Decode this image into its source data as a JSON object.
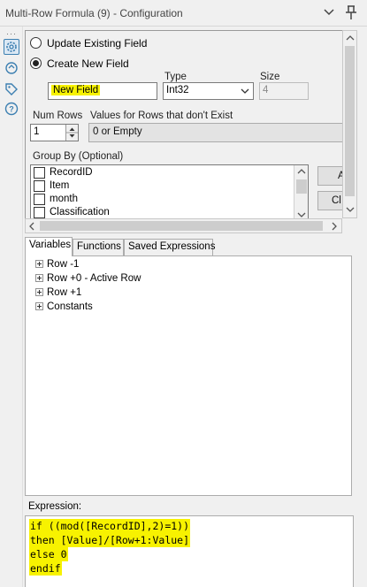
{
  "window": {
    "title": "Multi-Row Formula (9) - Configuration"
  },
  "colors": {
    "highlight": "#f7f200",
    "selected_icon_border": "#3c7fb1"
  },
  "config": {
    "update_existing_label": "Update Existing Field",
    "create_new_label": "Create New  Field",
    "new_field_value": "New Field",
    "type_label": "Type",
    "type_value": "Int32",
    "size_label": "Size",
    "size_value": "4",
    "num_rows_label": "Num Rows",
    "num_rows_value": "1",
    "values_nonexist_label": "Values for Rows that don't Exist",
    "values_nonexist_value": "0 or Empty",
    "group_by_label": "Group By (Optional)",
    "group_by_fields": [
      "RecordID",
      "Item",
      "month",
      "Classification"
    ],
    "side_button_1": "A",
    "side_button_2": "Cl"
  },
  "tabs": [
    "Variables",
    "Functions",
    "Saved Expressions"
  ],
  "variables_tree": [
    "Row -1",
    "Row +0 - Active Row",
    "Row +1",
    "Constants"
  ],
  "expression": {
    "label": "Expression:",
    "lines": [
      "if ((mod([RecordID],2)=1))",
      "then [Value]/[Row+1:Value]",
      "else 0",
      "endif"
    ]
  }
}
